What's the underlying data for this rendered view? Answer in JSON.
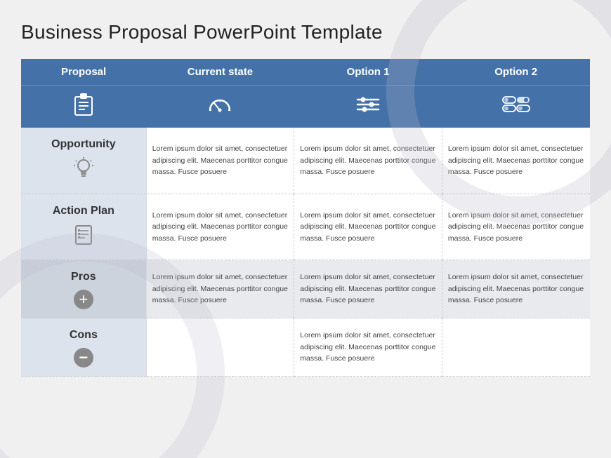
{
  "slide": {
    "title": "Business Proposal PowerPoint Template",
    "header": {
      "col1": "Proposal",
      "col2": "Current state",
      "col3": "Option 1",
      "col4": "Option 2"
    },
    "rows": [
      {
        "label": "Opportunity",
        "row_id": "opportunity",
        "icon": "lightbulb",
        "col2": "Lorem ipsum dolor sit amet, consectetuer adipiscing elit. Maecenas porttitor congue massa. Fusce posuere",
        "col3": "Lorem ipsum dolor sit amet, consectetuer adipiscing elit. Maecenas porttitor congue massa. Fusce posuere",
        "col4": "Lorem ipsum dolor sit amet, consectetuer adipiscing elit. Maecenas porttitor congue massa. Fusce posuere",
        "shaded": false
      },
      {
        "label": "Action Plan",
        "row_id": "action-plan",
        "icon": "list",
        "col2": "Lorem ipsum dolor sit amet, consectetuer adipiscing elit. Maecenas porttitor congue massa. Fusce posuere",
        "col3": "Lorem ipsum dolor sit amet, consectetuer adipiscing elit. Maecenas porttitor congue massa. Fusce posuere",
        "col4": "Lorem ipsum dolor sit amet, consectetuer adipiscing elit. Maecenas porttitor congue massa. Fusce posuere",
        "shaded": false
      },
      {
        "label": "Pros",
        "row_id": "pros",
        "icon": "plus",
        "col2": "Lorem ipsum dolor sit amet, consectetuer adipiscing elit. Maecenas porttitor congue massa. Fusce posuere",
        "col3": "Lorem ipsum dolor sit amet, consectetuer adipiscing elit. Maecenas porttitor congue massa. Fusce posuere",
        "col4": "Lorem ipsum dolor sit amet, consectetuer adipiscing elit. Maecenas porttitor congue massa. Fusce posuere",
        "shaded": true
      },
      {
        "label": "Cons",
        "row_id": "cons",
        "icon": "minus",
        "col2": "",
        "col3": "Lorem ipsum dolor sit amet, consectetuer adipiscing elit. Maecenas porttitor congue massa. Fusce posuere",
        "col4": "",
        "shaded": false
      }
    ]
  }
}
